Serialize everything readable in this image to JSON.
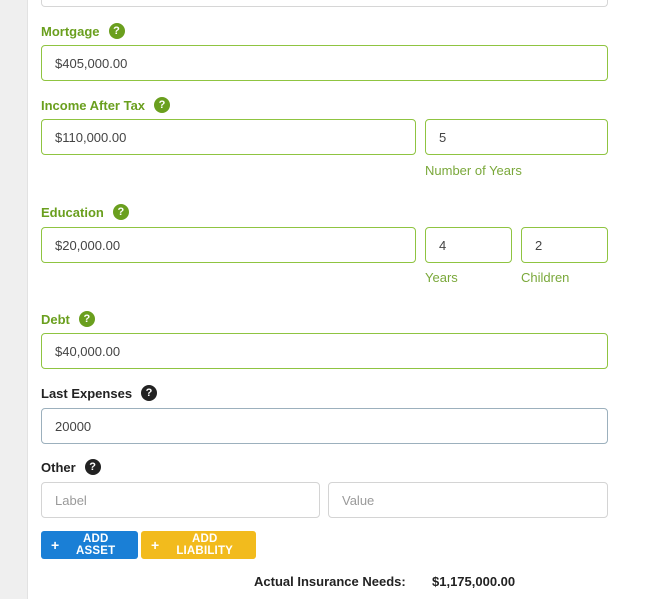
{
  "mortgage": {
    "label": "Mortgage",
    "help": "?",
    "value": "$405,000.00"
  },
  "income": {
    "label": "Income After Tax",
    "help": "?",
    "value": "$110,000.00",
    "years_value": "5",
    "years_caption": "Number of Years"
  },
  "education": {
    "label": "Education",
    "help": "?",
    "value": "$20,000.00",
    "years_value": "4",
    "years_caption": "Years",
    "children_value": "2",
    "children_caption": "Children"
  },
  "debt": {
    "label": "Debt",
    "help": "?",
    "value": "$40,000.00"
  },
  "last_expenses": {
    "label": "Last Expenses",
    "help": "?",
    "value": "20000"
  },
  "other": {
    "label": "Other",
    "help": "?",
    "label_placeholder": "Label",
    "value_placeholder": "Value"
  },
  "buttons": {
    "add_asset": "ADD ASSET",
    "add_liability": "ADD LIABILITY",
    "plus": "+"
  },
  "summary": {
    "label": "Actual Insurance Needs:",
    "value": "$1,175,000.00"
  },
  "colors": {
    "accent_green": "#6a9f1e",
    "field_border_green": "#8fc441",
    "asset_blue": "#1a7fd6",
    "liability_yellow": "#f2bb1d"
  }
}
